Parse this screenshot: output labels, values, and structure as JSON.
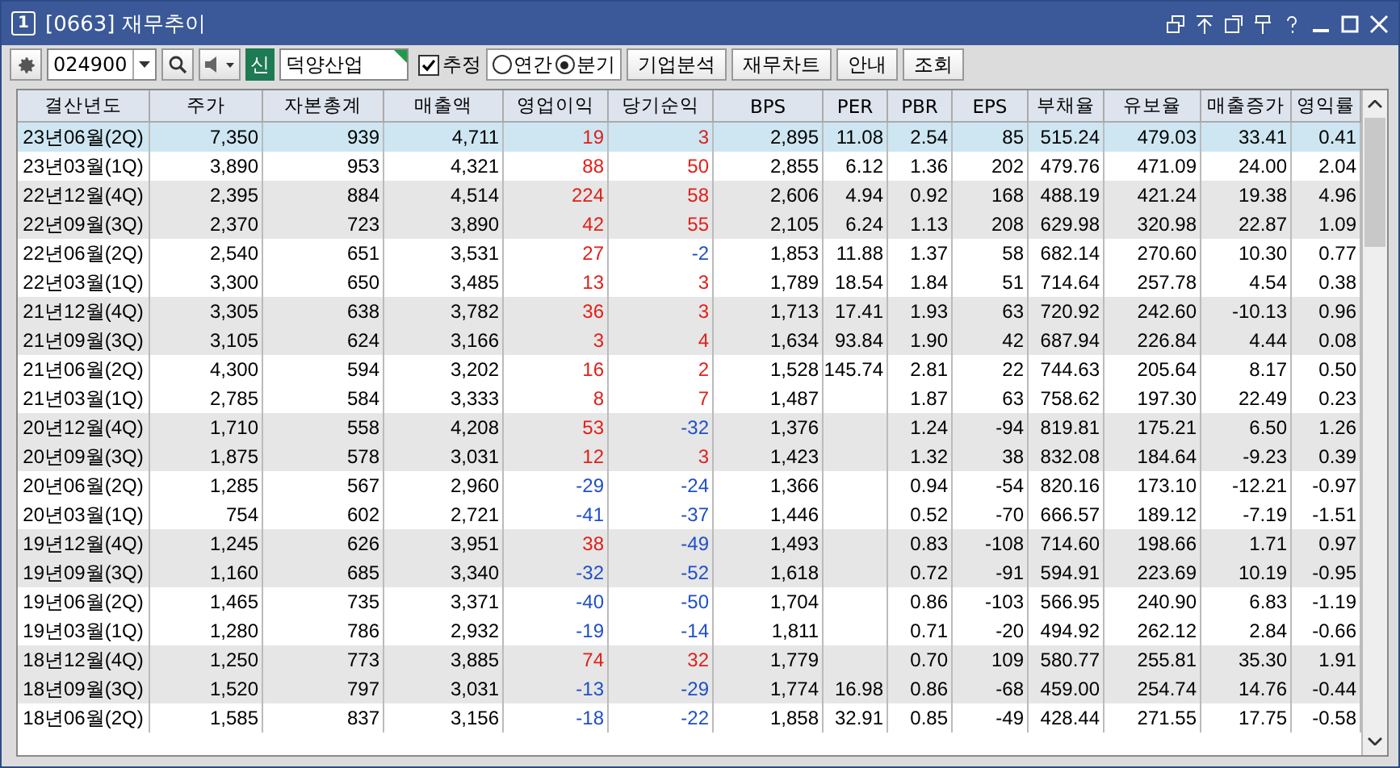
{
  "window": {
    "badge": "1",
    "title": "[0663] 재무추이"
  },
  "toolbar": {
    "code": "024900",
    "tag": "신",
    "company": "덕양산업",
    "estimate": {
      "label": "추정",
      "checked": true
    },
    "period": [
      {
        "label": "연간",
        "selected": false
      },
      {
        "label": "분기",
        "selected": true
      }
    ],
    "buttons": [
      "기업분석",
      "재무차트",
      "안내",
      "조회"
    ]
  },
  "table": {
    "columns": [
      "결산년도",
      "주가",
      "자본총계",
      "매출액",
      "영업이익",
      "당기순익",
      "BPS",
      "PER",
      "PBR",
      "EPS",
      "부채율",
      "유보율",
      "매출증가",
      "영익률"
    ],
    "rows": [
      {
        "selected": true,
        "profit_up": true,
        "net_up": true,
        "cells": [
          "23년06월(2Q)",
          "7,350",
          "939",
          "4,711",
          "19",
          "3",
          "2,895",
          "11.08",
          "2.54",
          "85",
          "515.24",
          "479.03",
          "33.41",
          "0.41"
        ]
      },
      {
        "selected": false,
        "profit_up": true,
        "net_up": true,
        "cells": [
          "23년03월(1Q)",
          "3,890",
          "953",
          "4,321",
          "88",
          "50",
          "2,855",
          "6.12",
          "1.36",
          "202",
          "479.76",
          "471.09",
          "24.00",
          "2.04"
        ]
      },
      {
        "selected": false,
        "profit_up": true,
        "net_up": true,
        "cells": [
          "22년12월(4Q)",
          "2,395",
          "884",
          "4,514",
          "224",
          "58",
          "2,606",
          "4.94",
          "0.92",
          "168",
          "488.19",
          "421.24",
          "19.38",
          "4.96"
        ]
      },
      {
        "selected": false,
        "profit_up": true,
        "net_up": true,
        "cells": [
          "22년09월(3Q)",
          "2,370",
          "723",
          "3,890",
          "42",
          "55",
          "2,105",
          "6.24",
          "1.13",
          "208",
          "629.98",
          "320.98",
          "22.87",
          "1.09"
        ]
      },
      {
        "selected": false,
        "profit_up": true,
        "net_up": false,
        "cells": [
          "22년06월(2Q)",
          "2,540",
          "651",
          "3,531",
          "27",
          "-2",
          "1,853",
          "11.88",
          "1.37",
          "58",
          "682.14",
          "270.60",
          "10.30",
          "0.77"
        ]
      },
      {
        "selected": false,
        "profit_up": true,
        "net_up": true,
        "cells": [
          "22년03월(1Q)",
          "3,300",
          "650",
          "3,485",
          "13",
          "3",
          "1,789",
          "18.54",
          "1.84",
          "51",
          "714.64",
          "257.78",
          "4.54",
          "0.38"
        ]
      },
      {
        "selected": false,
        "profit_up": true,
        "net_up": true,
        "cells": [
          "21년12월(4Q)",
          "3,305",
          "638",
          "3,782",
          "36",
          "3",
          "1,713",
          "17.41",
          "1.93",
          "63",
          "720.92",
          "242.60",
          "-10.13",
          "0.96"
        ]
      },
      {
        "selected": false,
        "profit_up": true,
        "net_up": true,
        "cells": [
          "21년09월(3Q)",
          "3,105",
          "624",
          "3,166",
          "3",
          "4",
          "1,634",
          "93.84",
          "1.90",
          "42",
          "687.94",
          "226.84",
          "4.44",
          "0.08"
        ]
      },
      {
        "selected": false,
        "profit_up": true,
        "net_up": true,
        "cells": [
          "21년06월(2Q)",
          "4,300",
          "594",
          "3,202",
          "16",
          "2",
          "1,528",
          "145.74",
          "2.81",
          "22",
          "744.63",
          "205.64",
          "8.17",
          "0.50"
        ]
      },
      {
        "selected": false,
        "profit_up": true,
        "net_up": true,
        "cells": [
          "21년03월(1Q)",
          "2,785",
          "584",
          "3,333",
          "8",
          "7",
          "1,487",
          null,
          "1.87",
          "63",
          "758.62",
          "197.30",
          "22.49",
          "0.23"
        ]
      },
      {
        "selected": false,
        "profit_up": true,
        "net_up": false,
        "cells": [
          "20년12월(4Q)",
          "1,710",
          "558",
          "4,208",
          "53",
          "-32",
          "1,376",
          null,
          "1.24",
          "-94",
          "819.81",
          "175.21",
          "6.50",
          "1.26"
        ]
      },
      {
        "selected": false,
        "profit_up": true,
        "net_up": true,
        "cells": [
          "20년09월(3Q)",
          "1,875",
          "578",
          "3,031",
          "12",
          "3",
          "1,423",
          null,
          "1.32",
          "38",
          "832.08",
          "184.64",
          "-9.23",
          "0.39"
        ]
      },
      {
        "selected": false,
        "profit_up": false,
        "net_up": false,
        "cells": [
          "20년06월(2Q)",
          "1,285",
          "567",
          "2,960",
          "-29",
          "-24",
          "1,366",
          null,
          "0.94",
          "-54",
          "820.16",
          "173.10",
          "-12.21",
          "-0.97"
        ]
      },
      {
        "selected": false,
        "profit_up": false,
        "net_up": false,
        "cells": [
          "20년03월(1Q)",
          "754",
          "602",
          "2,721",
          "-41",
          "-37",
          "1,446",
          null,
          "0.52",
          "-70",
          "666.57",
          "189.12",
          "-7.19",
          "-1.51"
        ]
      },
      {
        "selected": false,
        "profit_up": true,
        "net_up": false,
        "cells": [
          "19년12월(4Q)",
          "1,245",
          "626",
          "3,951",
          "38",
          "-49",
          "1,493",
          null,
          "0.83",
          "-108",
          "714.60",
          "198.66",
          "1.71",
          "0.97"
        ]
      },
      {
        "selected": false,
        "profit_up": false,
        "net_up": false,
        "cells": [
          "19년09월(3Q)",
          "1,160",
          "685",
          "3,340",
          "-32",
          "-52",
          "1,618",
          null,
          "0.72",
          "-91",
          "594.91",
          "223.69",
          "10.19",
          "-0.95"
        ]
      },
      {
        "selected": false,
        "profit_up": false,
        "net_up": false,
        "cells": [
          "19년06월(2Q)",
          "1,465",
          "735",
          "3,371",
          "-40",
          "-50",
          "1,704",
          null,
          "0.86",
          "-103",
          "566.95",
          "240.90",
          "6.83",
          "-1.19"
        ]
      },
      {
        "selected": false,
        "profit_up": false,
        "net_up": false,
        "cells": [
          "19년03월(1Q)",
          "1,280",
          "786",
          "2,932",
          "-19",
          "-14",
          "1,811",
          null,
          "0.71",
          "-20",
          "494.92",
          "262.12",
          "2.84",
          "-0.66"
        ]
      },
      {
        "selected": false,
        "profit_up": true,
        "net_up": true,
        "cells": [
          "18년12월(4Q)",
          "1,250",
          "773",
          "3,885",
          "74",
          "32",
          "1,779",
          null,
          "0.70",
          "109",
          "580.77",
          "255.81",
          "35.30",
          "1.91"
        ]
      },
      {
        "selected": false,
        "profit_up": false,
        "net_up": false,
        "cells": [
          "18년09월(3Q)",
          "1,520",
          "797",
          "3,031",
          "-13",
          "-29",
          "1,774",
          "16.98",
          "0.86",
          "-68",
          "459.00",
          "254.74",
          "14.76",
          "-0.44"
        ]
      },
      {
        "selected": false,
        "profit_up": false,
        "net_up": false,
        "cells": [
          "18년06월(2Q)",
          "1,585",
          "837",
          "3,156",
          "-18",
          "-22",
          "1,858",
          "32.91",
          "0.85",
          "-49",
          "428.44",
          "271.55",
          "17.75",
          "-0.58"
        ]
      }
    ]
  }
}
